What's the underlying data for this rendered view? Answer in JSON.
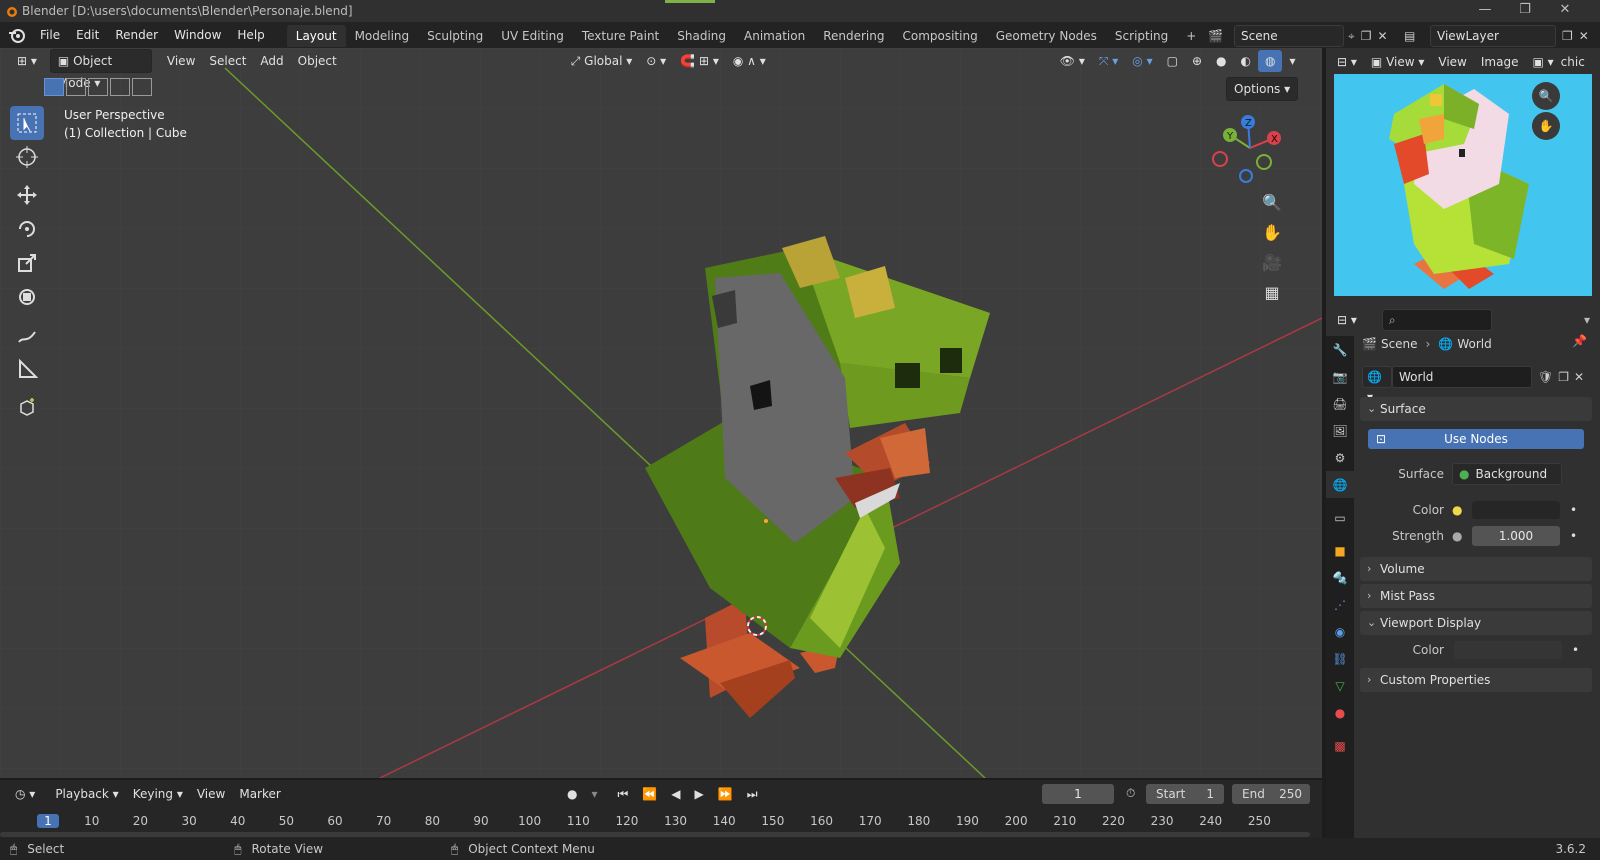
{
  "titlebar": {
    "title": "Blender [D:\\users\\documents\\Blender\\Personaje.blend]",
    "minimize": "—",
    "restore": "❐",
    "close": "✕"
  },
  "menubar": {
    "menus": [
      "File",
      "Edit",
      "Render",
      "Window",
      "Help"
    ],
    "workspaces": [
      "Layout",
      "Modeling",
      "Sculpting",
      "UV Editing",
      "Texture Paint",
      "Shading",
      "Animation",
      "Rendering",
      "Compositing",
      "Geometry Nodes",
      "Scripting"
    ],
    "add_workspace": "+",
    "scene": "Scene",
    "view_layer": "ViewLayer"
  },
  "viewport": {
    "mode": "Object Mode",
    "menus": [
      "View",
      "Select",
      "Add",
      "Object"
    ],
    "transform_orientation": "Global",
    "options": "Options",
    "overlay_text": [
      "User Perspective",
      "(1) Collection | Cube"
    ],
    "gizmo_axes": [
      "X",
      "Y",
      "Z"
    ]
  },
  "preview": {
    "menus": [
      "View",
      "View",
      "Image"
    ],
    "image_name": "chic"
  },
  "properties": {
    "search_placeholder": "",
    "breadcrumb": [
      "Scene",
      "World"
    ],
    "world_name": "World",
    "surface_panel": {
      "title": "Surface",
      "use_nodes": "Use Nodes",
      "surface_label": "Surface",
      "surface_value": "Background",
      "color_label": "Color",
      "strength_label": "Strength",
      "strength_value": "1.000"
    },
    "collapsed_panels": [
      "Volume",
      "Mist Pass"
    ],
    "viewport_display": {
      "title": "Viewport Display",
      "color_label": "Color"
    },
    "custom_properties": "Custom Properties"
  },
  "timeline": {
    "menus": [
      "Playback",
      "Keying",
      "View",
      "Marker"
    ],
    "current_frame": "1",
    "start_label": "Start",
    "start_value": "1",
    "end_label": "End",
    "end_value": "250",
    "ruler": [
      "1",
      "10",
      "20",
      "30",
      "40",
      "50",
      "60",
      "70",
      "80",
      "90",
      "100",
      "110",
      "120",
      "130",
      "140",
      "150",
      "160",
      "170",
      "180",
      "190",
      "200",
      "210",
      "220",
      "230",
      "240",
      "250"
    ]
  },
  "statusbar": {
    "items": [
      "Select",
      "Rotate View",
      "Object Context Menu"
    ],
    "version": "3.6.2"
  },
  "colors": {
    "accent": "#4772b3",
    "grid_bg": "#3d3d3d",
    "preview_bg": "#42c6f0",
    "char_green": "#7fa82a",
    "char_orange": "#d2693a"
  }
}
